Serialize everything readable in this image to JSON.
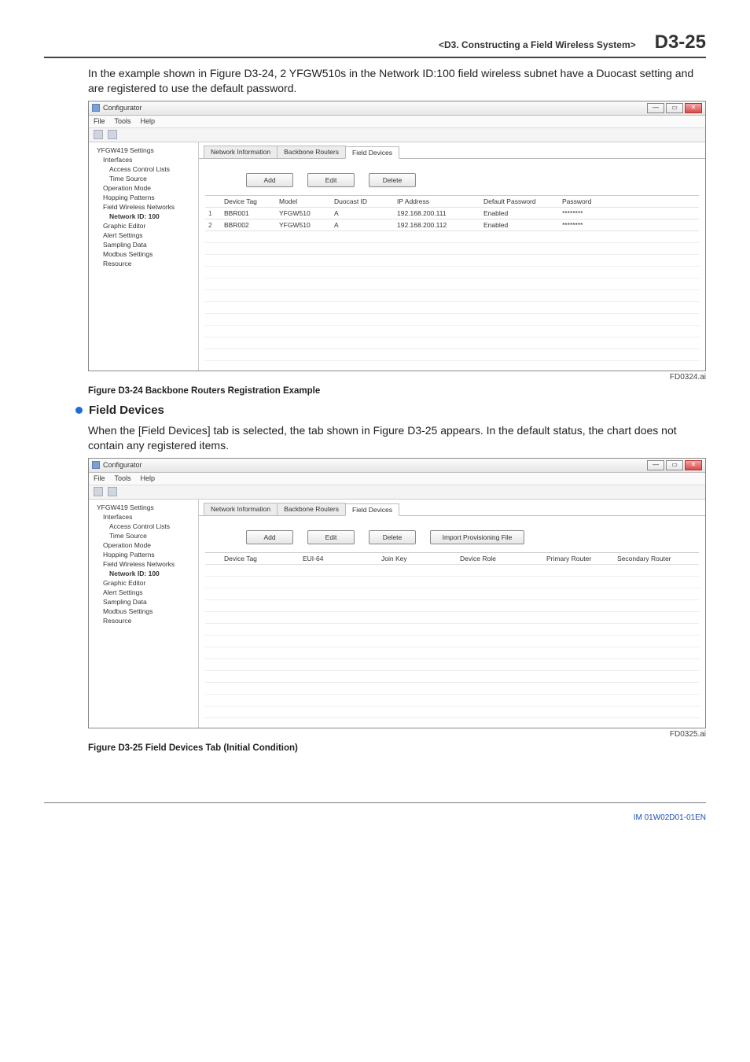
{
  "header": {
    "section": "<D3. Constructing a Field Wireless System>",
    "page_number": "D3-25"
  },
  "intro_text": "In the example shown in Figure D3-24, 2 YFGW510s in the Network ID:100 field wireless subnet have a Duocast setting and are registered to use the default password.",
  "fig1_id": "FD0324.ai",
  "fig1_caption": "Figure D3-24  Backbone Routers Registration Example",
  "bullet_heading": "Field Devices",
  "section_text": "When the [Field Devices] tab is selected, the tab shown in Figure D3-25 appears. In the default status, the chart does not contain any registered items.",
  "fig2_id": "FD0325.ai",
  "fig2_caption": "Figure D3-25 Field Devices Tab (Initial Condition)",
  "footer_doc": "IM 01W02D01-01EN",
  "window": {
    "title": "Configurator",
    "menus": [
      "File",
      "Tools",
      "Help"
    ]
  },
  "tree": {
    "root": "YFGW419 Settings",
    "items": [
      "Interfaces",
      "Access Control Lists",
      "Time Source",
      "Operation Mode",
      "Hopping Patterns",
      "Field Wireless Networks",
      "Network ID: 100",
      "Graphic Editor",
      "Alert Settings",
      "Sampling Data",
      "Modbus Settings",
      "Resource"
    ]
  },
  "screenshot1": {
    "tabs": [
      "Network Information",
      "Backbone Routers",
      "Field Devices"
    ],
    "active_tab_index": 2,
    "buttons": [
      "Add",
      "Edit",
      "Delete"
    ],
    "columns": [
      "Device Tag",
      "Model",
      "Duocast ID",
      "IP Address",
      "Default Password",
      "Password"
    ],
    "rows": [
      {
        "n": "1",
        "tag": "BBR001",
        "model": "YFGW510",
        "duo": "A",
        "ip": "192.168.200.111",
        "dp": "Enabled",
        "pw": "********"
      },
      {
        "n": "2",
        "tag": "BBR002",
        "model": "YFGW510",
        "duo": "A",
        "ip": "192.168.200.112",
        "dp": "Enabled",
        "pw": "********"
      }
    ]
  },
  "screenshot2": {
    "tabs": [
      "Network Information",
      "Backbone Routers",
      "Field Devices"
    ],
    "active_tab_index": 2,
    "buttons": [
      "Add",
      "Edit",
      "Delete",
      "Import Provisioning File"
    ],
    "columns": [
      "Device Tag",
      "EUI-64",
      "Join Key",
      "Device Role",
      "Primary Router",
      "Secondary Router"
    ]
  }
}
